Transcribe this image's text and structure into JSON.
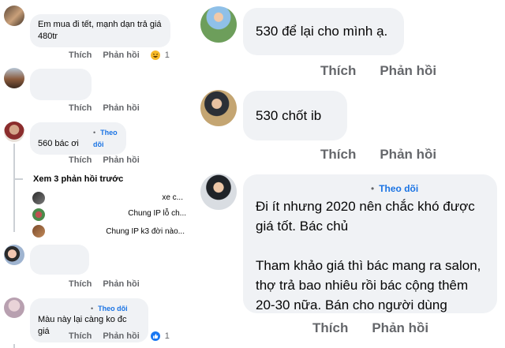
{
  "left": {
    "comments": [
      {
        "text": "Em mua đi tết, mạnh dạn trả giá 480tr",
        "actions": [
          "Thích",
          "Phản hồi"
        ],
        "reaction_count": "1"
      },
      {
        "text": "",
        "actions": [
          "Thích",
          "Phản hồi"
        ]
      },
      {
        "follow_label": "Theo dõi",
        "text": "560 bác ơi",
        "actions": [
          "Thích",
          "Phản hồi"
        ]
      },
      {
        "text": "",
        "actions": [
          "Thích",
          "Phản hồi"
        ]
      },
      {
        "follow_label": "Theo dõi",
        "text": "Màu này lại càng ko đc giá",
        "actions": [
          "Thích",
          "Phản hồi"
        ],
        "reaction_count": "1"
      }
    ],
    "show_previous": "Xem 3 phản hồi trước",
    "replies": [
      "xe c...",
      "Chung IP lỗ ch...",
      "Chung IP k3 đời nào..."
    ]
  },
  "right": {
    "comments": [
      {
        "text": "530 để lại cho mình ạ.",
        "actions": [
          "Thích",
          "Phản hồi"
        ]
      },
      {
        "text": "530 chốt ib",
        "actions": [
          "Thích",
          "Phản hồi"
        ]
      },
      {
        "follow_label": "Theo dõi",
        "paragraphs": [
          "Đi ít nhưng 2020 nên chắc khó được giá tốt. Bác chủ",
          "Tham khảo giá thì bác mang ra salon, thợ trả bao nhiêu rồi bác cộng thêm 20-30 nữa. Bán cho người dùng"
        ],
        "actions": [
          "Thích",
          "Phản hồi"
        ]
      }
    ]
  },
  "colors": {
    "bubble": "#f0f2f5",
    "action_text": "#65676b",
    "follow_blue": "#1b74e4",
    "like_blue": "#1877f2"
  },
  "icons": [
    "laughing-reaction-icon",
    "like-reaction-icon"
  ]
}
